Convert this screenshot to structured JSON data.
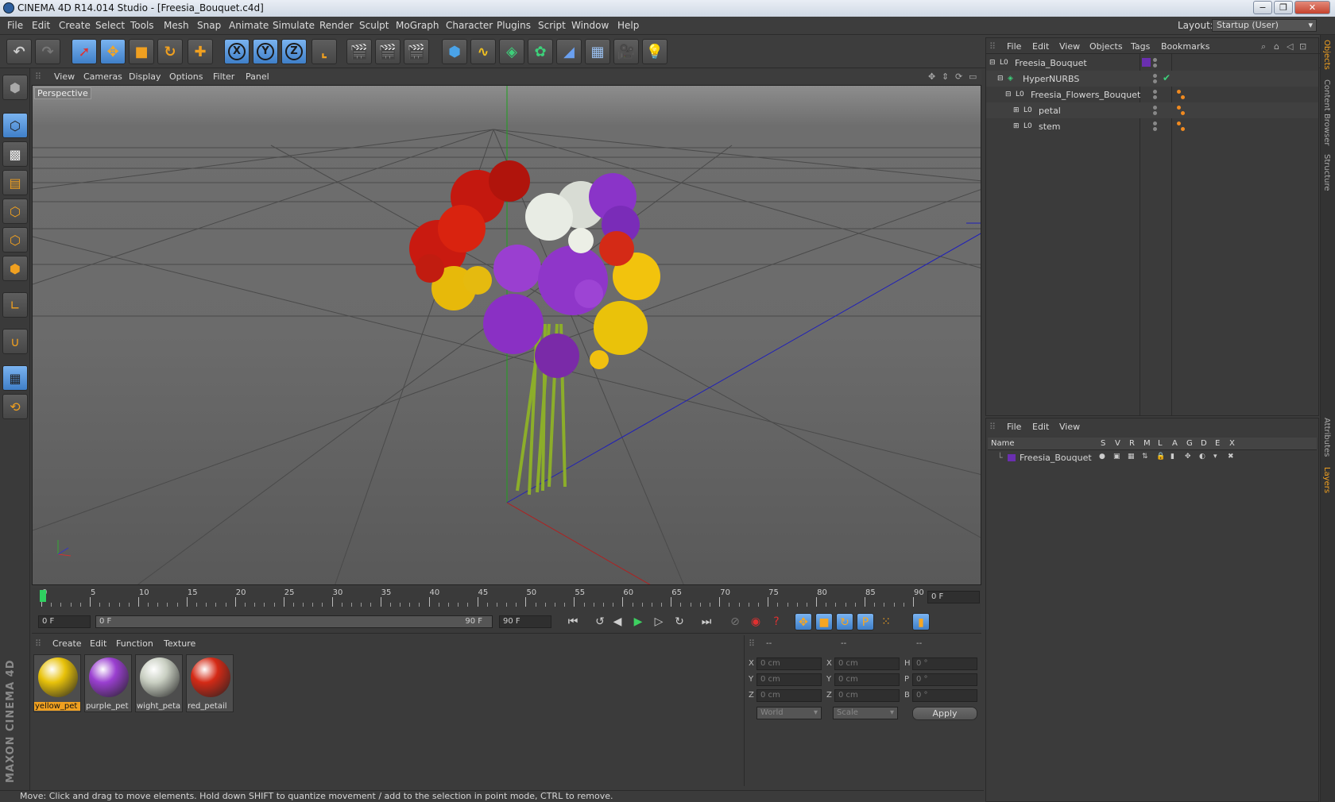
{
  "window": {
    "title": "CINEMA 4D R14.014 Studio - [Freesia_Bouquet.c4d]",
    "min": "−",
    "restore": "❐",
    "close": "✕"
  },
  "menubar": [
    "File",
    "Edit",
    "Create",
    "Select",
    "Tools",
    "Mesh",
    "Snap",
    "Animate",
    "Simulate",
    "Render",
    "Sculpt",
    "MoGraph",
    "Character",
    "Plugins",
    "Script",
    "Window",
    "Help"
  ],
  "layout": {
    "label": "Layout:",
    "value": "Startup (User)"
  },
  "toolbar_axis": [
    "X",
    "Y",
    "Z"
  ],
  "viewport": {
    "menu": [
      "View",
      "Cameras",
      "Display",
      "Options",
      "Filter",
      "Panel"
    ],
    "label": "Perspective"
  },
  "timeline": {
    "ticks": [
      "0",
      "5",
      "10",
      "15",
      "20",
      "25",
      "30",
      "35",
      "40",
      "45",
      "50",
      "55",
      "60",
      "65",
      "70",
      "75",
      "80",
      "85",
      "90"
    ],
    "current_frame": "0 F"
  },
  "transport": {
    "start": "0 F",
    "range_start": "0 F",
    "range_end": "90 F",
    "end": "90 F"
  },
  "materials": {
    "menu": [
      "Create",
      "Edit",
      "Function",
      "Texture"
    ],
    "items": [
      {
        "name": "yellow_pet",
        "color": "#e8c20a",
        "selected": true
      },
      {
        "name": "purple_pet",
        "color": "#9a3fd0",
        "selected": false
      },
      {
        "name": "wight_peta",
        "color": "#c9cfc2",
        "selected": false
      },
      {
        "name": "red_petail",
        "color": "#d42a16",
        "selected": false
      }
    ]
  },
  "coords": {
    "header": [
      "--",
      "--",
      "--"
    ],
    "rows": [
      {
        "a": "X",
        "av": "0 cm",
        "b": "X",
        "bv": "0 cm",
        "c": "H",
        "cv": "0 °"
      },
      {
        "a": "Y",
        "av": "0 cm",
        "b": "Y",
        "bv": "0 cm",
        "c": "P",
        "cv": "0 °"
      },
      {
        "a": "Z",
        "av": "0 cm",
        "b": "Z",
        "bv": "0 cm",
        "c": "B",
        "cv": "0 °"
      }
    ],
    "world": "World",
    "scale": "Scale",
    "apply": "Apply"
  },
  "objects": {
    "menu": [
      "File",
      "Edit",
      "View",
      "Objects",
      "Tags",
      "Bookmarks"
    ],
    "items": [
      {
        "name": "Freesia_Bouquet",
        "icon": "null-icon"
      },
      {
        "name": "HyperNURBS",
        "icon": "hypernurbs-icon"
      },
      {
        "name": "Freesia_Flowers_Bouquet",
        "icon": "null-icon"
      },
      {
        "name": "petal",
        "icon": "null-icon"
      },
      {
        "name": "stem",
        "icon": "null-icon"
      }
    ]
  },
  "layers": {
    "menu": [
      "File",
      "Edit",
      "View"
    ],
    "columns": [
      "Name",
      "S",
      "V",
      "R",
      "M",
      "L",
      "A",
      "G",
      "D",
      "E",
      "X"
    ],
    "items": [
      {
        "name": "Freesia_Bouquet",
        "color": "#6a2fb0"
      }
    ]
  },
  "side_tabs": [
    "Objects",
    "Content Browser",
    "Structure",
    "Attributes",
    "Layers"
  ],
  "status": "Move: Click and drag to move elements. Hold down SHIFT to quantize movement / add to the selection in point mode, CTRL to remove.",
  "brand": "MAXON CINEMA 4D",
  "colors": {
    "accent": "#f0a020",
    "active_blue": "#4a8ad8"
  }
}
